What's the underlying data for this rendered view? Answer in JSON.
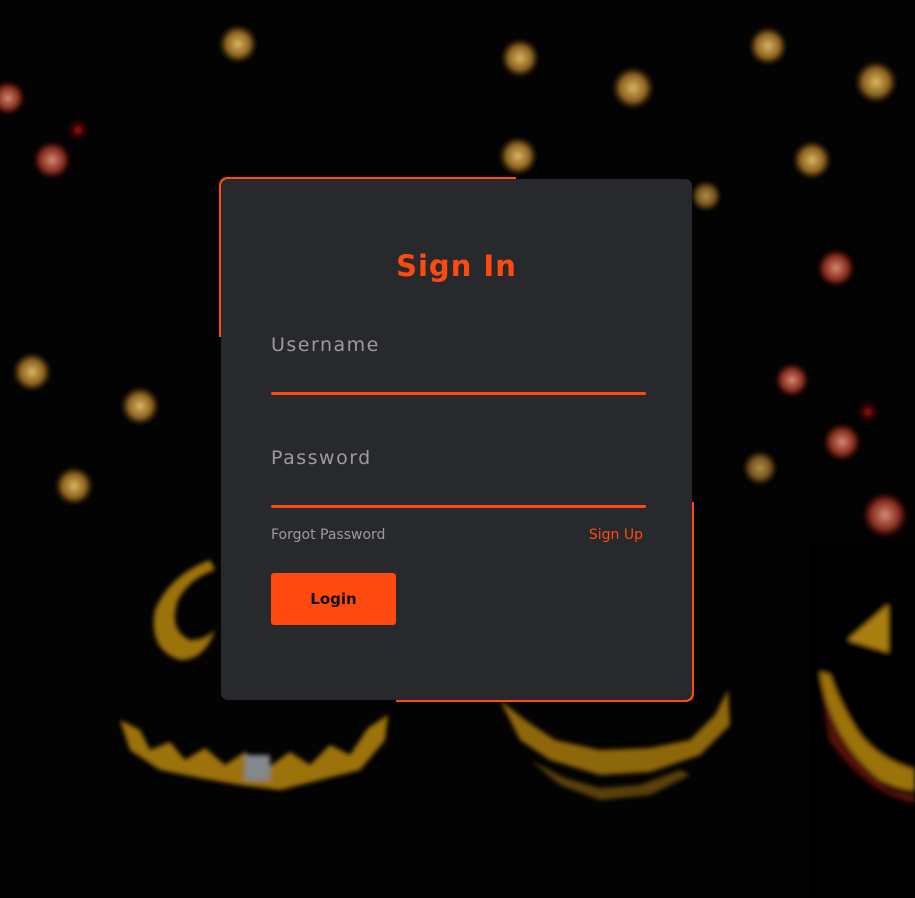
{
  "login": {
    "title": "Sign In",
    "username_label": "Username",
    "password_label": "Password",
    "username_value": "",
    "password_value": "",
    "forgot_password": "Forgot Password",
    "sign_up": "Sign Up",
    "login_button": "Login"
  },
  "theme": {
    "accent": "#ff4a0f",
    "card_bg": "#28292d",
    "label_color": "#9c9c9c",
    "page_bg": "#000000"
  },
  "background": {
    "image": "halloween-jack-o-lantern-bokeh"
  }
}
